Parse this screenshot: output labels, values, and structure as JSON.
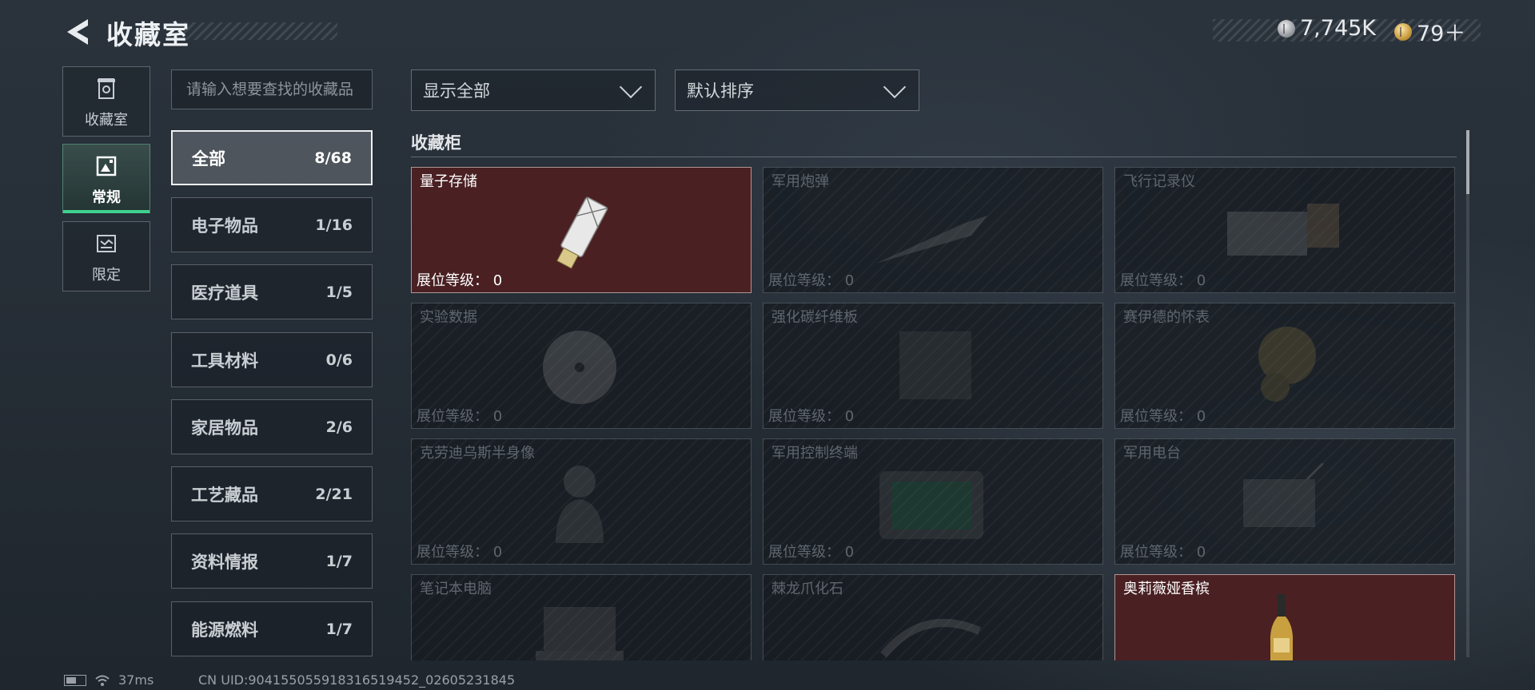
{
  "header": {
    "title": "收藏室",
    "currency": [
      {
        "icon": "silver-coin-icon",
        "value": "7,745K"
      },
      {
        "icon": "gold-coin-icon",
        "value": "79＋"
      }
    ]
  },
  "left_nav": [
    {
      "label": "收藏室",
      "icon": "vault-icon",
      "active": false
    },
    {
      "label": "常规",
      "icon": "frame-icon",
      "active": true
    },
    {
      "label": "限定",
      "icon": "limited-icon",
      "active": false
    }
  ],
  "search": {
    "placeholder": "请输入想要查找的收藏品"
  },
  "categories": [
    {
      "name": "全部",
      "count": "8/68",
      "active": true
    },
    {
      "name": "电子物品",
      "count": "1/16"
    },
    {
      "name": "医疗道具",
      "count": "1/5"
    },
    {
      "name": "工具材料",
      "count": "0/6"
    },
    {
      "name": "家居物品",
      "count": "2/6"
    },
    {
      "name": "工艺藏品",
      "count": "2/21"
    },
    {
      "name": "资料情报",
      "count": "1/7"
    },
    {
      "name": "能源燃料",
      "count": "1/7"
    }
  ],
  "filters": {
    "display": "显示全部",
    "sort": "默认排序"
  },
  "section_title": "收藏柜",
  "level_label": "展位等级：",
  "items": [
    {
      "name": "量子存储",
      "level": "0",
      "owned": true
    },
    {
      "name": "军用炮弹",
      "level": "0",
      "owned": false
    },
    {
      "name": "飞行记录仪",
      "level": "0",
      "owned": false
    },
    {
      "name": "实验数据",
      "level": "0",
      "owned": false
    },
    {
      "name": "强化碳纤维板",
      "level": "0",
      "owned": false
    },
    {
      "name": "赛伊德的怀表",
      "level": "0",
      "owned": false
    },
    {
      "name": "克劳迪乌斯半身像",
      "level": "0",
      "owned": false
    },
    {
      "name": "军用控制终端",
      "level": "0",
      "owned": false
    },
    {
      "name": "军用电台",
      "level": "0",
      "owned": false
    },
    {
      "name": "笔记本电脑",
      "level": "",
      "owned": false
    },
    {
      "name": "棘龙爪化石",
      "level": "",
      "owned": false
    },
    {
      "name": "奥莉薇娅香槟",
      "level": "",
      "owned": true
    }
  ],
  "footer": {
    "ping": "37ms",
    "uid": "CN UID:904155055918316519452_02605231845"
  },
  "colors": {
    "accent": "#3fd08e",
    "owned_bg": "#4a2023"
  }
}
